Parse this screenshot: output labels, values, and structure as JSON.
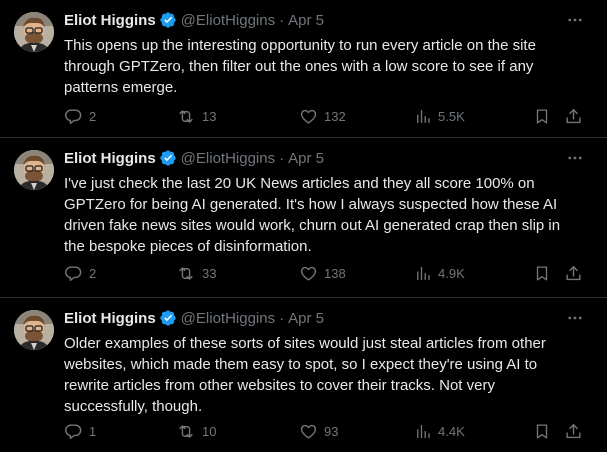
{
  "tweets": [
    {
      "author": "Eliot Higgins",
      "handle": "@EliotHiggins",
      "separator": "·",
      "date": "Apr 5",
      "lines": [
        "This opens up the interesting opportunity to run every article on the site",
        "through GPTZero, then filter out the ones with a low score to see if any",
        "patterns emerge."
      ],
      "replies": "2",
      "reposts": "13",
      "likes": "132",
      "views": "5.5K"
    },
    {
      "author": "Eliot Higgins",
      "handle": "@EliotHiggins",
      "separator": "·",
      "date": "Apr 5",
      "lines": [
        "I've just check the last 20 UK News articles and they all score 100% on",
        "GPTZero for being AI generated. It's how I always suspected how these AI",
        "driven fake news sites would work, churn out AI generated crap then slip in",
        "the bespoke pieces of disinformation."
      ],
      "replies": "2",
      "reposts": "33",
      "likes": "138",
      "views": "4.9K"
    },
    {
      "author": "Eliot Higgins",
      "handle": "@EliotHiggins",
      "separator": "·",
      "date": "Apr 5",
      "lines": [
        "Older examples of these sorts of sites would just steal articles from other",
        "websites, which made them easy to spot, so I expect they're using AI to",
        "rewrite articles from other websites to cover their tracks. Not very",
        "successfully, though."
      ],
      "replies": "1",
      "reposts": "10",
      "likes": "93",
      "views": "4.4K"
    }
  ],
  "icons": {
    "reply": "reply-icon",
    "repost": "repost-icon",
    "like": "heart-icon",
    "views": "views-icon",
    "bookmark": "bookmark-icon",
    "share": "share-icon",
    "more": "more-icon",
    "verified": "verified-badge-icon"
  },
  "colors": {
    "background": "#000000",
    "text": "#e7e9ea",
    "muted": "#71767b",
    "verified": "#1d9bf0",
    "divider": "#2f3336"
  }
}
